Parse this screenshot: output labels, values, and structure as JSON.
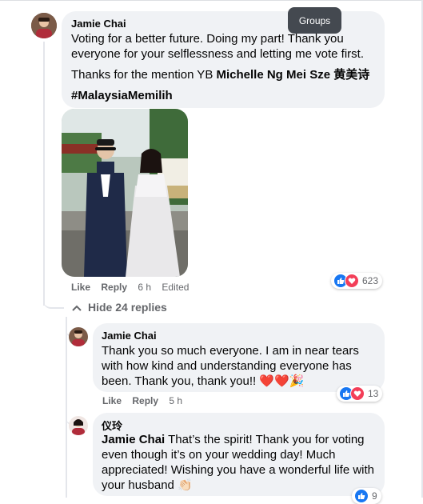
{
  "tooltip": {
    "label": "Groups"
  },
  "post": {
    "author": "Jamie Chai",
    "line1": "Voting for a better future. Doing my part! Thank you everyone for your selflessness and letting me vote first.",
    "mention_prefix": "Thanks for the mention YB ",
    "mention_name": "Michelle Ng Mei Sze 黄美诗",
    "hashtag": "#MalaysiaMemilih",
    "photo_sign": "GLA",
    "actions": {
      "like": "Like",
      "reply": "Reply",
      "time": "6 h",
      "edited": "Edited"
    },
    "reactions": "623"
  },
  "hide_replies": {
    "label": "Hide 24 replies"
  },
  "replies": [
    {
      "author": "Jamie Chai",
      "text": "Thank you so much everyone. I am in near tears with how kind and understanding everyone has been. Thank you, thank you!!",
      "emoji": "❤️❤️🎉",
      "actions": {
        "like": "Like",
        "reply": "Reply",
        "time": "5 h"
      },
      "reactions": "13"
    },
    {
      "author": "仪玲",
      "mention": "Jamie Chai",
      "text": " That’s the spirit! Thank you for voting even though it’s on your wedding day! Much appreciated! Wishing you have a wonderful life with your husband",
      "emoji": "👏🏻",
      "reactions": "9"
    }
  ],
  "colors": {
    "bubble": "#f0f2f5",
    "like": "#1877f2",
    "love": "#f33e58",
    "meta": "#65676b"
  },
  "icons": [
    "like-icon",
    "love-icon",
    "chevron-up-icon"
  ]
}
